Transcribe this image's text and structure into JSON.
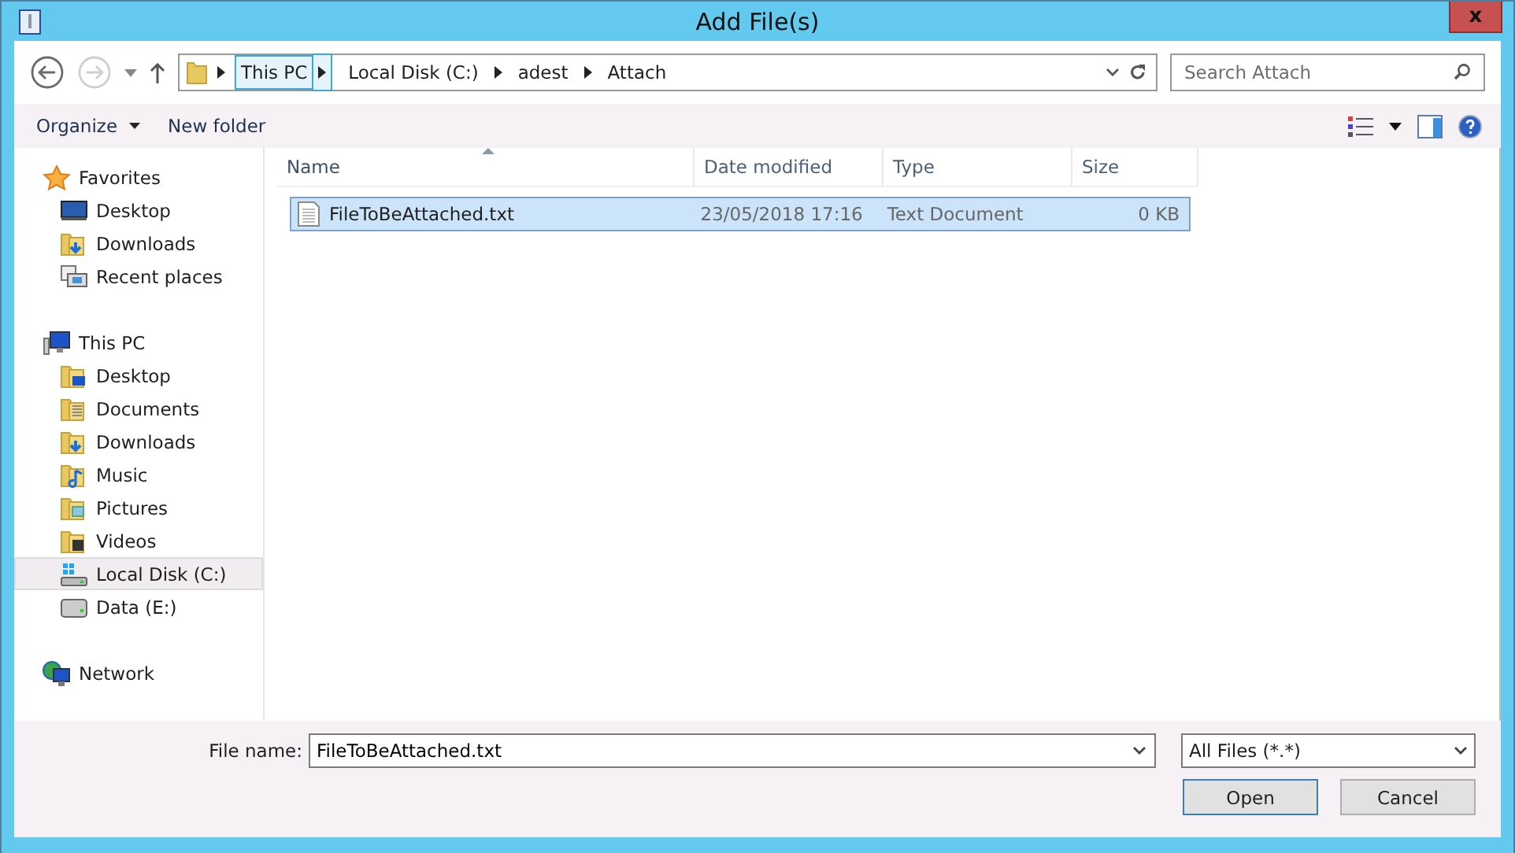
{
  "window": {
    "title": "Add File(s)",
    "close_label": "x"
  },
  "nav": {
    "back_disabled": false,
    "forward_disabled": true,
    "breadcrumb": [
      {
        "label": "This PC",
        "selected": true
      },
      {
        "label": "Local Disk (C:)",
        "selected": false
      },
      {
        "label": "adest",
        "selected": false
      },
      {
        "label": "Attach",
        "selected": false
      }
    ],
    "search": {
      "placeholder": "Search Attach"
    }
  },
  "toolbar": {
    "organize": "Organize",
    "new_folder": "New folder"
  },
  "sidebar": [
    {
      "label": "Favorites",
      "kind": "star",
      "children": [
        {
          "label": "Desktop",
          "kind": "desktop",
          "selected": false
        },
        {
          "label": "Downloads",
          "kind": "downloads",
          "selected": false
        },
        {
          "label": "Recent places",
          "kind": "recent",
          "selected": false
        }
      ]
    },
    {
      "label": "This PC",
      "kind": "pc",
      "children": [
        {
          "label": "Desktop",
          "kind": "folder-desktop",
          "selected": false
        },
        {
          "label": "Documents",
          "kind": "documents",
          "selected": false
        },
        {
          "label": "Downloads",
          "kind": "downloads",
          "selected": false
        },
        {
          "label": "Music",
          "kind": "music",
          "selected": false
        },
        {
          "label": "Pictures",
          "kind": "pictures",
          "selected": false
        },
        {
          "label": "Videos",
          "kind": "videos",
          "selected": false
        },
        {
          "label": "Local Disk (C:)",
          "kind": "system-drive",
          "selected": true
        },
        {
          "label": "Data (E:)",
          "kind": "drive",
          "selected": false
        }
      ]
    },
    {
      "label": "Network",
      "kind": "network"
    }
  ],
  "table": {
    "columns": [
      {
        "label": "Name",
        "sorted": true
      },
      {
        "label": "Date modified",
        "sorted": false
      },
      {
        "label": "Type",
        "sorted": false
      },
      {
        "label": "Size",
        "sorted": false
      }
    ],
    "rows": [
      {
        "name": "FileToBeAttached.txt",
        "date": "23/05/2018 17:16",
        "type": "Text Document",
        "size": "0 KB",
        "selected": true
      }
    ]
  },
  "footer": {
    "file_name_label": "File name:",
    "file_name": "FileToBeAttached.txt",
    "file_type": "All Files (*.*)",
    "buttons": [
      {
        "label": "Open",
        "kind": "default"
      },
      {
        "label": "Cancel",
        "kind": "normal"
      }
    ]
  }
}
